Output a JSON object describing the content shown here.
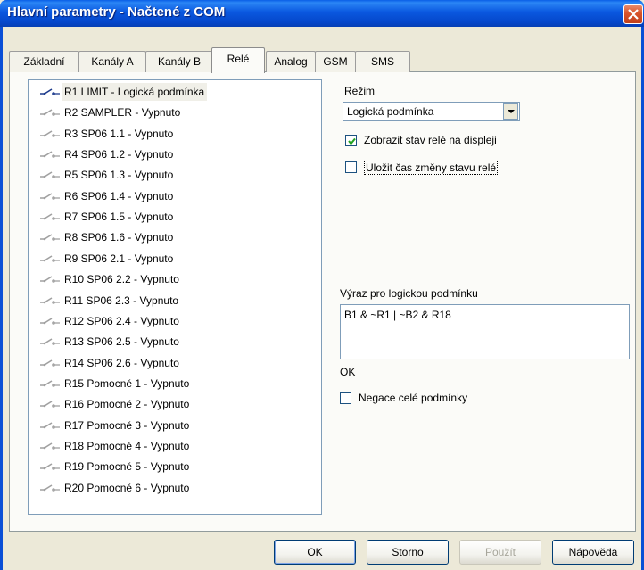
{
  "window": {
    "title": "Hlavní parametry - Načtené z COM"
  },
  "tabs": [
    {
      "label": "Základní"
    },
    {
      "label": "Kanály A"
    },
    {
      "label": "Kanály B"
    },
    {
      "label": "Relé"
    },
    {
      "label": "Analog"
    },
    {
      "label": "GSM"
    },
    {
      "label": "SMS"
    }
  ],
  "active_tab": "Relé",
  "relays": [
    {
      "label": "R1 LIMIT - Logická podmínka",
      "selected": true
    },
    {
      "label": "R2 SAMPLER - Vypnuto"
    },
    {
      "label": "R3 SP06 1.1 - Vypnuto"
    },
    {
      "label": "R4 SP06 1.2 - Vypnuto"
    },
    {
      "label": "R5 SP06 1.3 - Vypnuto"
    },
    {
      "label": "R6 SP06 1.4 - Vypnuto"
    },
    {
      "label": "R7 SP06 1.5 - Vypnuto"
    },
    {
      "label": "R8 SP06 1.6 - Vypnuto"
    },
    {
      "label": "R9 SP06 2.1 - Vypnuto"
    },
    {
      "label": "R10 SP06 2.2 - Vypnuto"
    },
    {
      "label": "R11 SP06 2.3 - Vypnuto"
    },
    {
      "label": "R12 SP06 2.4 - Vypnuto"
    },
    {
      "label": "R13 SP06 2.5 - Vypnuto"
    },
    {
      "label": "R14 SP06 2.6 - Vypnuto"
    },
    {
      "label": "R15 Pomocné 1 - Vypnuto"
    },
    {
      "label": "R16 Pomocné 2 - Vypnuto"
    },
    {
      "label": "R17 Pomocné 3 - Vypnuto"
    },
    {
      "label": "R18 Pomocné 4 - Vypnuto"
    },
    {
      "label": "R19 Pomocné 5 - Vypnuto"
    },
    {
      "label": "R20 Pomocné 6 - Vypnuto"
    }
  ],
  "settings": {
    "mode_label": "Režim",
    "mode_value": "Logická podmínka",
    "show_on_display_label": "Zobrazit stav relé na displeji",
    "show_on_display_checked": true,
    "save_time_label": "Uložit čas změny stavu relé",
    "save_time_checked": false,
    "expression_label": "Výraz pro logickou podmínku",
    "expression_value": "B1 & ~R1 | ~B2 & R18",
    "status_text": "OK",
    "negate_label": "Negace celé podmínky",
    "negate_checked": false
  },
  "buttons": {
    "ok": "OK",
    "cancel": "Storno",
    "apply": "Použít",
    "help": "Nápověda"
  },
  "colors": {
    "title_bar": "#0a58e0",
    "close_button": "#d8532a",
    "selected_icon": "#1c3a8c",
    "inactive_icon": "#a0a0a0"
  }
}
